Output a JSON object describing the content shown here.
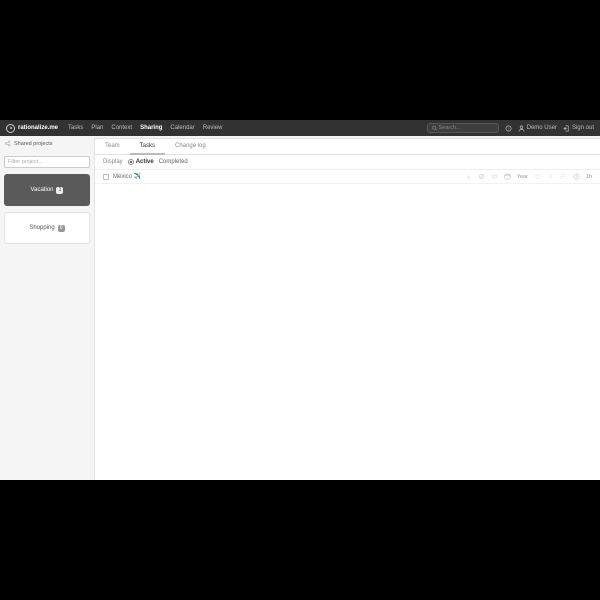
{
  "header": {
    "brand": "rationalize.me",
    "nav": {
      "tasks": "Tasks",
      "plan": "Plan",
      "context": "Context",
      "sharing": "Sharing",
      "calendar": "Calendar",
      "review": "Review"
    },
    "search_placeholder": "Search...",
    "user": "Demo User",
    "signout": "Sign out"
  },
  "sidebar": {
    "shared_label": "Shared projects",
    "filter_placeholder": "Filter project...",
    "projects": [
      {
        "name": "Vacation",
        "count": "1"
      },
      {
        "name": "Shopping",
        "count": "0"
      }
    ]
  },
  "main": {
    "tabs": {
      "team": "Team",
      "tasks": "Tasks",
      "changelog": "Change log"
    },
    "display": {
      "label": "Display",
      "active": "Active",
      "completed": "Completed"
    },
    "task": {
      "title": "México ✈️",
      "year": "Year",
      "time": "1h"
    }
  }
}
